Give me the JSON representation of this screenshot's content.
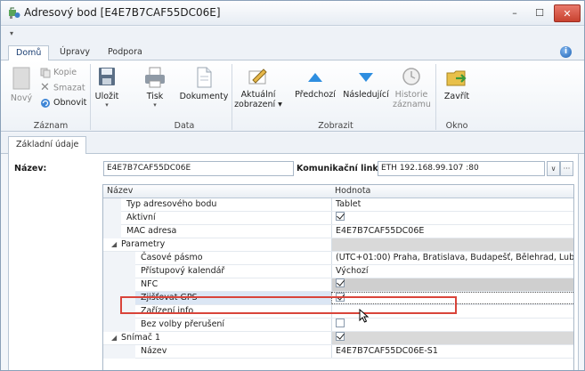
{
  "window": {
    "title": "Adresový bod [E4E7B7CAF55DC06E]"
  },
  "ribbon_tabs": [
    {
      "label": "Domů",
      "active": true
    },
    {
      "label": "Úpravy",
      "active": false
    },
    {
      "label": "Podpora",
      "active": false
    }
  ],
  "ribbon": {
    "zaznam": {
      "group": "Záznam",
      "novy": "Nový",
      "kopie": "Kopie",
      "smazat": "Smazat",
      "obnovit": "Obnovit"
    },
    "data": {
      "group": "Data",
      "ulozit": "Uložit",
      "tisk": "Tisk",
      "dokumenty": "Dokumenty"
    },
    "zobrazit": {
      "group": "Zobrazit",
      "aktualni_1": "Aktuální",
      "aktualni_2": "zobrazení",
      "predchozi": "Předchozí",
      "nasledujici": "Následující",
      "historie_1": "Historie",
      "historie_2": "záznamu"
    },
    "okno": {
      "group": "Okno",
      "zavrit": "Zavřít"
    }
  },
  "content_tab": "Základní údaje",
  "form": {
    "name_label": "Název:",
    "name_value": "E4E7B7CAF55DC06E",
    "link_label": "Komunikační linka:",
    "link_value": "ETH 192.168.99.107 :80"
  },
  "grid": {
    "col_name": "Název",
    "col_value": "Hodnota",
    "rows": [
      {
        "name": "Typ adresového bodu",
        "value": "Tablet"
      },
      {
        "name": "Aktivní",
        "check": true
      },
      {
        "name": "MAC adresa",
        "value": "E4E7B7CAF55DC06E"
      },
      {
        "name": "Parametry",
        "category": true
      },
      {
        "name": "Časové pásmo",
        "value": "(UTC+01:00) Praha, Bratislava, Budapešť, Bělehrad, Lublaň"
      },
      {
        "name": "Přístupový kalendář",
        "value": "Výchozí"
      },
      {
        "name": "NFC",
        "check": true
      },
      {
        "name": "Zjišťovat GPS",
        "check": true,
        "selected": true
      },
      {
        "name": "Zařízení info",
        "value": ""
      },
      {
        "name": "Bez volby přerušení",
        "check": false
      },
      {
        "name": "Snímač 1",
        "category": true,
        "check": true
      },
      {
        "name": "Název",
        "value": "E4E7B7CAF55DC06E-S1"
      }
    ]
  },
  "colors": {
    "accent": "#1f63b4",
    "highlight": "#d9443a",
    "close": "#c8412f"
  }
}
